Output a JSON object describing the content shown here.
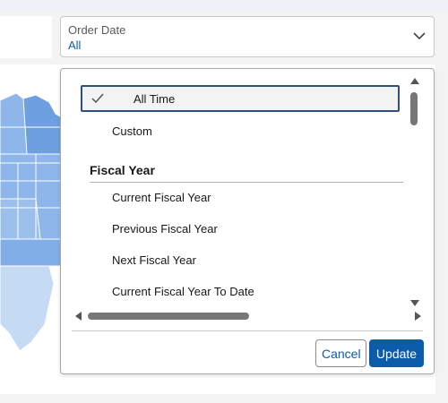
{
  "filter": {
    "label": "Order Date",
    "value": "All"
  },
  "dropdown": {
    "options_top": [
      {
        "label": "All Time",
        "selected": true
      },
      {
        "label": "Custom",
        "selected": false
      }
    ],
    "group_heading": "Fiscal Year",
    "fiscal_options": [
      "Current Fiscal Year",
      "Previous Fiscal Year",
      "Next Fiscal Year",
      "Current Fiscal Year To Date"
    ],
    "cancel_label": "Cancel",
    "update_label": "Update"
  },
  "colors": {
    "accent": "#0b5cab",
    "map_light": "#c5dbf3",
    "map_mid": "#8fb6ea",
    "map_dark": "#6e9fe0"
  },
  "icons": {
    "checkmark": "check-icon",
    "dropdown": "chevron-down-icon"
  }
}
